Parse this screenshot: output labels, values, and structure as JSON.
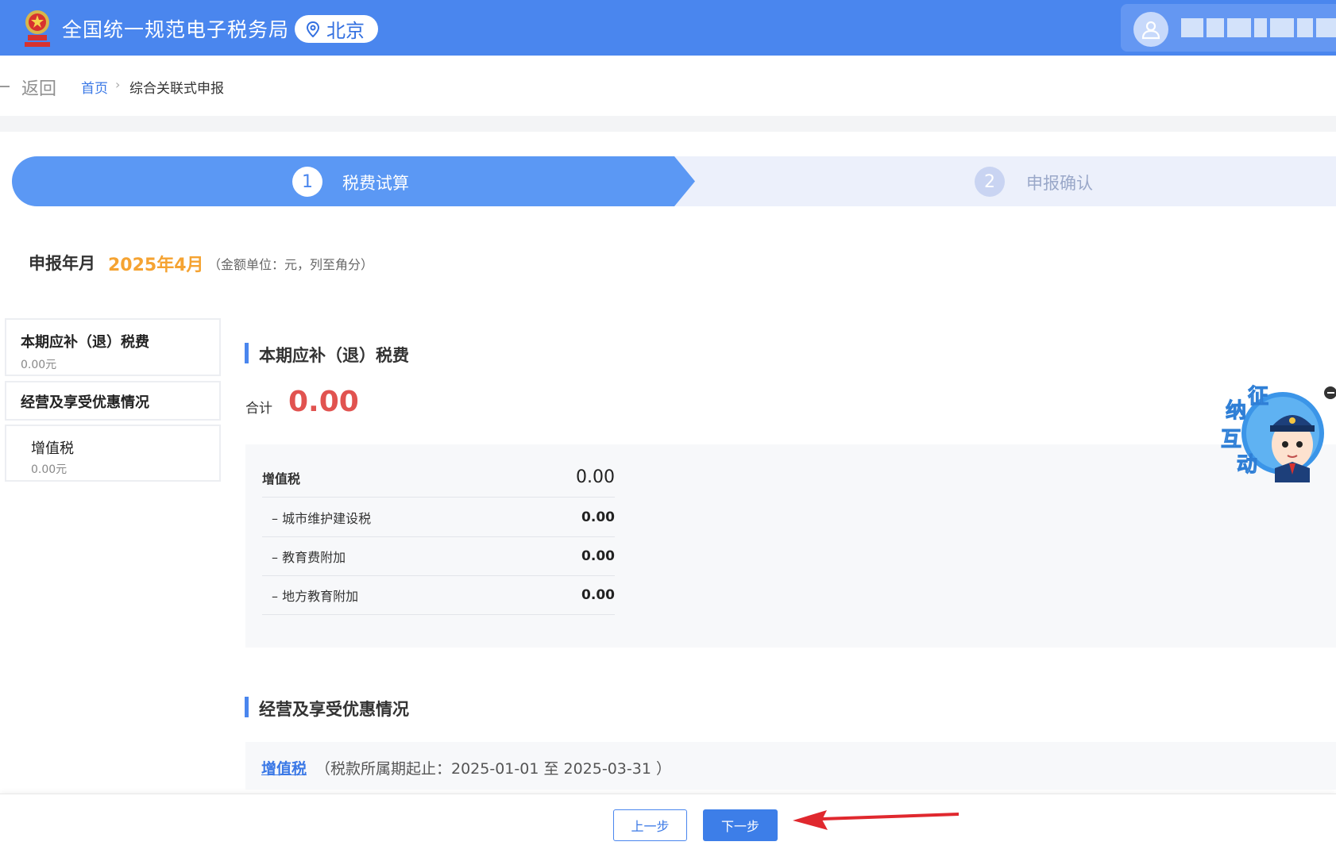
{
  "header": {
    "site_title": "全国统一规范电子税务局",
    "location": "北京",
    "brand_color": "#4a86ee"
  },
  "breadcrumb": {
    "back_label": "返回",
    "home_label": "首页",
    "separator": "›",
    "current_label": "综合关联式申报"
  },
  "steps": [
    {
      "number": "1",
      "label": "税费试算",
      "active": true
    },
    {
      "number": "2",
      "label": "申报确认",
      "active": false
    }
  ],
  "period": {
    "label": "申报年月",
    "value": "2025年4月",
    "note": "（金额单位：元，列至角分）"
  },
  "sidebar": {
    "items": [
      {
        "title": "本期应补（退）税费",
        "amount": "0.00元"
      },
      {
        "title": "经营及享受优惠情况"
      },
      {
        "title": "增值税",
        "amount": "0.00元"
      }
    ]
  },
  "main": {
    "section1_title": "本期应补（退）税费",
    "total_label": "合计",
    "total_value": "0.00",
    "tax_rows": [
      {
        "name": "增值税",
        "value": "0.00"
      },
      {
        "name": "– 城市维护建设税",
        "value": "0.00"
      },
      {
        "name": "– 教育费附加",
        "value": "0.00"
      },
      {
        "name": "– 地方教育附加",
        "value": "0.00"
      }
    ],
    "section2_title": "经营及享受优惠情况",
    "vat_link": "增值税",
    "vat_period": "（税款所属期起止：2025-01-01 至 2025-03-31 ）"
  },
  "footer": {
    "prev_label": "上一步",
    "next_label": "下一步"
  },
  "mascot": {
    "text": [
      "征",
      "纳",
      "互",
      "动"
    ]
  },
  "colors": {
    "accent": "#4a86ee",
    "total_red": "#e15350",
    "period_orange": "#f5a332",
    "arrow_red": "#e0282e"
  }
}
